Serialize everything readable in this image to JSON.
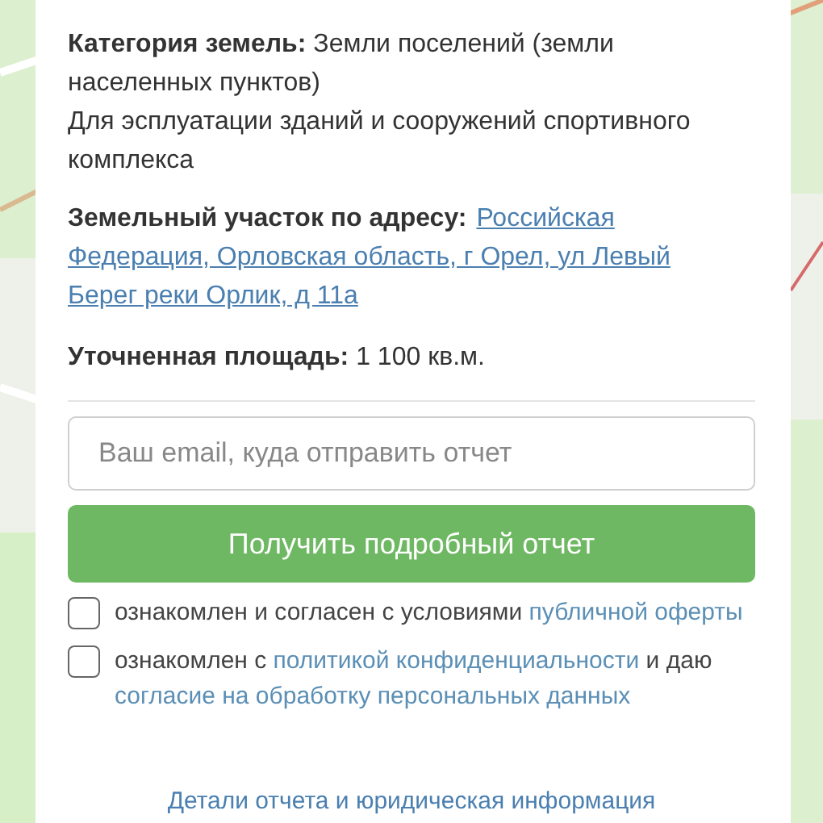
{
  "details": [
    {
      "label": "Категория земель:",
      "text": "Земли поселений (земли населенных пунктов)"
    },
    {
      "text": "Для эсплуатации зданий и сооружений спортивного комплекса"
    },
    {
      "label": "Земельный участок по адресу:",
      "link_lines": [
        "Российская",
        "Федерация, Орловская область, г Орел, ул Левый",
        "Берег реки Орлик, д 11а"
      ]
    },
    {
      "label": "Уточненная площадь:",
      "text": "1 100 кв.м."
    }
  ],
  "email": {
    "placeholder": "Ваш email, куда отправить отчет"
  },
  "submit": "Получить подробный отчет",
  "agreements": [
    {
      "checked": false,
      "parts": [
        {
          "text": "ознакомлен и согласен с условиями ",
          "link": false
        },
        {
          "text": "публичной оферты",
          "link": true
        }
      ]
    },
    {
      "checked": false,
      "parts": [
        {
          "text": "ознакомлен с ",
          "link": false
        },
        {
          "text": "политикой конфиденциальности",
          "link": true
        },
        {
          "text": " и даю ",
          "link": false
        },
        {
          "text": "согласие на обработку персональных данных",
          "link": true
        }
      ]
    }
  ],
  "footer_link": "Детали отчета и юридическая информация"
}
